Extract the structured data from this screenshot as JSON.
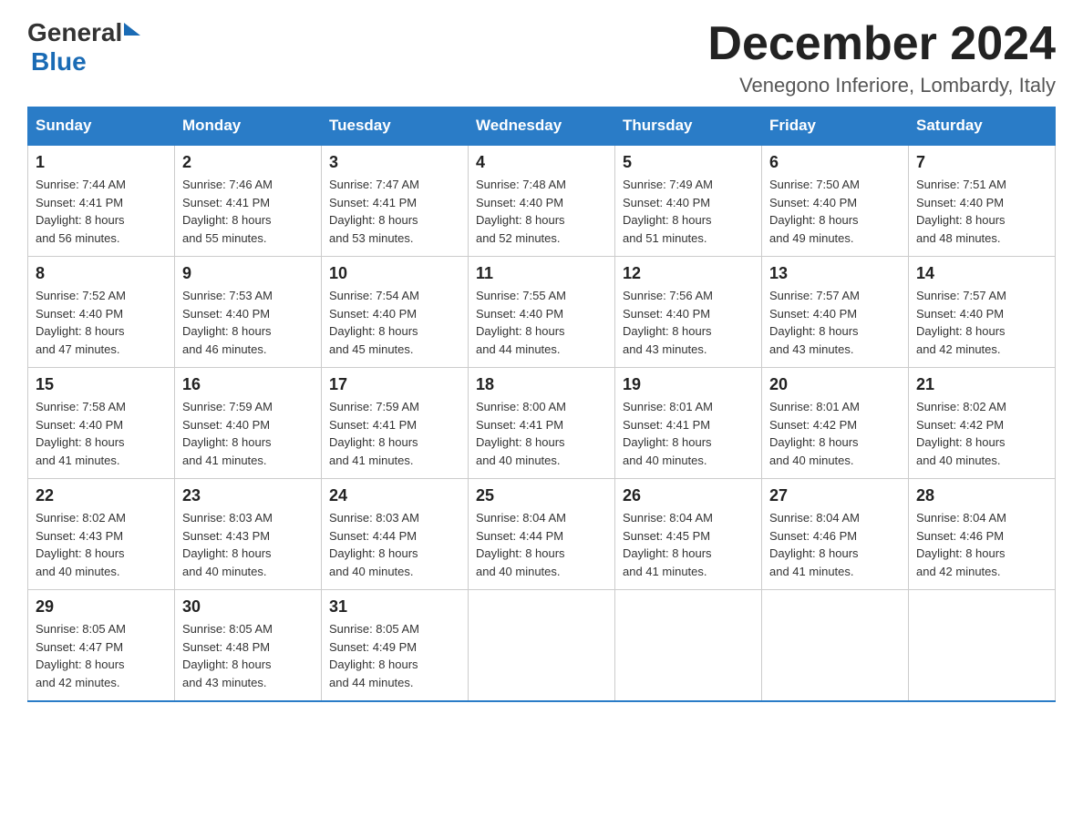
{
  "header": {
    "logo_general": "General",
    "logo_blue": "Blue",
    "month_title": "December 2024",
    "subtitle": "Venegono Inferiore, Lombardy, Italy"
  },
  "days_of_week": [
    "Sunday",
    "Monday",
    "Tuesday",
    "Wednesday",
    "Thursday",
    "Friday",
    "Saturday"
  ],
  "weeks": [
    [
      {
        "day": "1",
        "info": "Sunrise: 7:44 AM\nSunset: 4:41 PM\nDaylight: 8 hours\nand 56 minutes."
      },
      {
        "day": "2",
        "info": "Sunrise: 7:46 AM\nSunset: 4:41 PM\nDaylight: 8 hours\nand 55 minutes."
      },
      {
        "day": "3",
        "info": "Sunrise: 7:47 AM\nSunset: 4:41 PM\nDaylight: 8 hours\nand 53 minutes."
      },
      {
        "day": "4",
        "info": "Sunrise: 7:48 AM\nSunset: 4:40 PM\nDaylight: 8 hours\nand 52 minutes."
      },
      {
        "day": "5",
        "info": "Sunrise: 7:49 AM\nSunset: 4:40 PM\nDaylight: 8 hours\nand 51 minutes."
      },
      {
        "day": "6",
        "info": "Sunrise: 7:50 AM\nSunset: 4:40 PM\nDaylight: 8 hours\nand 49 minutes."
      },
      {
        "day": "7",
        "info": "Sunrise: 7:51 AM\nSunset: 4:40 PM\nDaylight: 8 hours\nand 48 minutes."
      }
    ],
    [
      {
        "day": "8",
        "info": "Sunrise: 7:52 AM\nSunset: 4:40 PM\nDaylight: 8 hours\nand 47 minutes."
      },
      {
        "day": "9",
        "info": "Sunrise: 7:53 AM\nSunset: 4:40 PM\nDaylight: 8 hours\nand 46 minutes."
      },
      {
        "day": "10",
        "info": "Sunrise: 7:54 AM\nSunset: 4:40 PM\nDaylight: 8 hours\nand 45 minutes."
      },
      {
        "day": "11",
        "info": "Sunrise: 7:55 AM\nSunset: 4:40 PM\nDaylight: 8 hours\nand 44 minutes."
      },
      {
        "day": "12",
        "info": "Sunrise: 7:56 AM\nSunset: 4:40 PM\nDaylight: 8 hours\nand 43 minutes."
      },
      {
        "day": "13",
        "info": "Sunrise: 7:57 AM\nSunset: 4:40 PM\nDaylight: 8 hours\nand 43 minutes."
      },
      {
        "day": "14",
        "info": "Sunrise: 7:57 AM\nSunset: 4:40 PM\nDaylight: 8 hours\nand 42 minutes."
      }
    ],
    [
      {
        "day": "15",
        "info": "Sunrise: 7:58 AM\nSunset: 4:40 PM\nDaylight: 8 hours\nand 41 minutes."
      },
      {
        "day": "16",
        "info": "Sunrise: 7:59 AM\nSunset: 4:40 PM\nDaylight: 8 hours\nand 41 minutes."
      },
      {
        "day": "17",
        "info": "Sunrise: 7:59 AM\nSunset: 4:41 PM\nDaylight: 8 hours\nand 41 minutes."
      },
      {
        "day": "18",
        "info": "Sunrise: 8:00 AM\nSunset: 4:41 PM\nDaylight: 8 hours\nand 40 minutes."
      },
      {
        "day": "19",
        "info": "Sunrise: 8:01 AM\nSunset: 4:41 PM\nDaylight: 8 hours\nand 40 minutes."
      },
      {
        "day": "20",
        "info": "Sunrise: 8:01 AM\nSunset: 4:42 PM\nDaylight: 8 hours\nand 40 minutes."
      },
      {
        "day": "21",
        "info": "Sunrise: 8:02 AM\nSunset: 4:42 PM\nDaylight: 8 hours\nand 40 minutes."
      }
    ],
    [
      {
        "day": "22",
        "info": "Sunrise: 8:02 AM\nSunset: 4:43 PM\nDaylight: 8 hours\nand 40 minutes."
      },
      {
        "day": "23",
        "info": "Sunrise: 8:03 AM\nSunset: 4:43 PM\nDaylight: 8 hours\nand 40 minutes."
      },
      {
        "day": "24",
        "info": "Sunrise: 8:03 AM\nSunset: 4:44 PM\nDaylight: 8 hours\nand 40 minutes."
      },
      {
        "day": "25",
        "info": "Sunrise: 8:04 AM\nSunset: 4:44 PM\nDaylight: 8 hours\nand 40 minutes."
      },
      {
        "day": "26",
        "info": "Sunrise: 8:04 AM\nSunset: 4:45 PM\nDaylight: 8 hours\nand 41 minutes."
      },
      {
        "day": "27",
        "info": "Sunrise: 8:04 AM\nSunset: 4:46 PM\nDaylight: 8 hours\nand 41 minutes."
      },
      {
        "day": "28",
        "info": "Sunrise: 8:04 AM\nSunset: 4:46 PM\nDaylight: 8 hours\nand 42 minutes."
      }
    ],
    [
      {
        "day": "29",
        "info": "Sunrise: 8:05 AM\nSunset: 4:47 PM\nDaylight: 8 hours\nand 42 minutes."
      },
      {
        "day": "30",
        "info": "Sunrise: 8:05 AM\nSunset: 4:48 PM\nDaylight: 8 hours\nand 43 minutes."
      },
      {
        "day": "31",
        "info": "Sunrise: 8:05 AM\nSunset: 4:49 PM\nDaylight: 8 hours\nand 44 minutes."
      },
      {
        "day": "",
        "info": ""
      },
      {
        "day": "",
        "info": ""
      },
      {
        "day": "",
        "info": ""
      },
      {
        "day": "",
        "info": ""
      }
    ]
  ]
}
